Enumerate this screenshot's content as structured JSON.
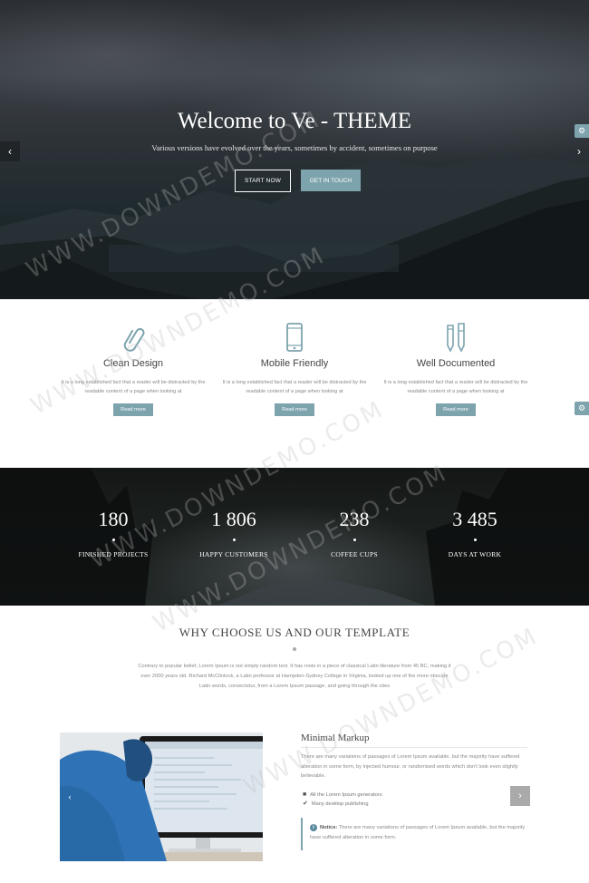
{
  "hero": {
    "title": "Welcome to Ve - THEME",
    "subtitle": "Various versions have evolved over the years, sometimes by accident, sometimes on purpose",
    "btn_start": "START NOW",
    "btn_touch": "GET IN TOUCH",
    "accent": "#7da3ad"
  },
  "features": [
    {
      "icon": "paperclip-icon",
      "title": "Clean Design",
      "text": "It is a long established fact that a reader will be distracted by the readable content of a page when looking at",
      "button": "Read more"
    },
    {
      "icon": "mobile-phone-icon",
      "title": "Mobile Friendly",
      "text": "It is a long established fact that a reader will be distracted by the readable content of a page when looking at",
      "button": "Read more"
    },
    {
      "icon": "pencil-pen-icon",
      "title": "Well Documented",
      "text": "It is a long established fact that a reader will be distracted by the readable content of a page when looking at",
      "button": "Read more"
    }
  ],
  "stats": [
    {
      "num": "180",
      "label": "FINISHED PROJECTS"
    },
    {
      "num": "1 806",
      "label": "HAPPY CUSTOMERS"
    },
    {
      "num": "238",
      "label": "COFFEE CUPS"
    },
    {
      "num": "3 485",
      "label": "DAYS AT WORK"
    }
  ],
  "why": {
    "title": "WHY CHOOSE US AND OUR TEMPLATE",
    "text": "Contrary to popular belief, Lorem Ipsum is not simply random text. It has roots in a piece of classical Latin literature from 45 BC, making it over 2000 years old. Richard McClintock, a Latin professor at Hampden-Sydney College in Virginia, looked up one of the more obscure Latin words, consectetur, from a Lorem Ipsum passage, and going through the cites"
  },
  "minimal": {
    "title": "Minimal Markup",
    "text": "There are many variations of passages of Lorem Ipsum available, but the majority have suffered alteration in some form, by injected humour, or randomised words which don't look even slightly believable.",
    "list": [
      "All the Lorem Ipsum generators",
      "Many desktop publishing"
    ],
    "notice_label": "Notice:",
    "notice_text": "There are many variations of passages of Lorem Ipsum available, but the majority have suffered alteration in some form."
  },
  "watermark": "WWW.DOWNDEMO.COM"
}
